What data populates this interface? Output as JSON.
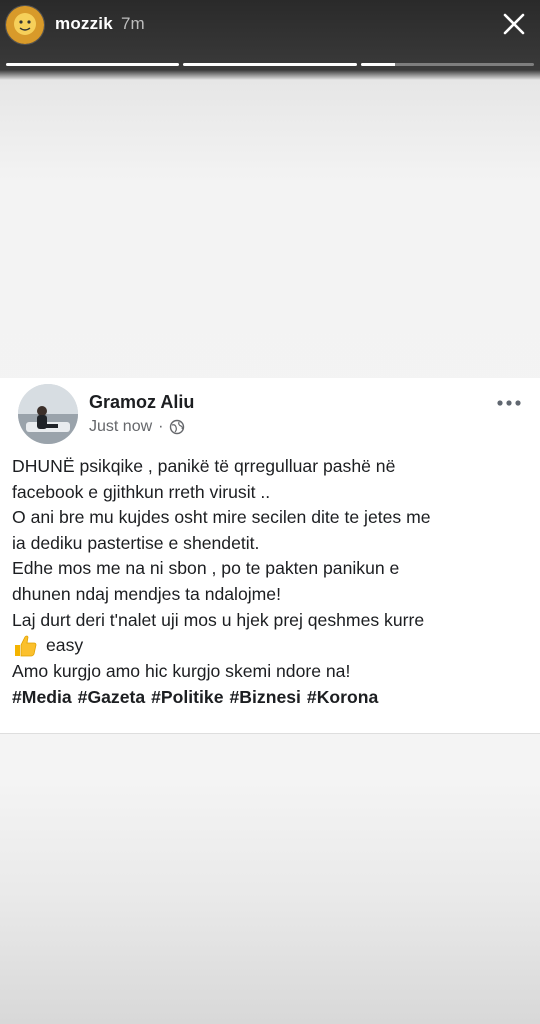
{
  "story": {
    "username": "mozzik",
    "time_ago": "7m",
    "progress": [
      1.0,
      1.0,
      0.2
    ]
  },
  "post": {
    "author": "Gramoz Aliu",
    "timestamp": "Just now",
    "audience_icon": "globe-icon",
    "lines": [
      "DHUNË psikqike , panikë të qrregulluar pashë në",
      "facebook e gjithkun rreth virusit ..",
      "O ani bre mu kujdes osht mire secilen dite te jetes me",
      "ia dediku pastertise e shendetit.",
      "Edhe mos me na ni sbon , po te pakten panikun e",
      "dhunen ndaj mendjes ta ndalojme!",
      "Laj durt deri t'nalet uji mos u hjek prej qeshmes kurre"
    ],
    "emoji_text": "easy",
    "emoji_icon": "thumbs-up-icon",
    "closing_line": "Amo kurgjo amo hic kurgjo skemi ndore na!",
    "hashtags": [
      "#Media",
      "#Gazeta",
      "#Politike",
      "#Biznesi",
      "#Korona"
    ]
  }
}
